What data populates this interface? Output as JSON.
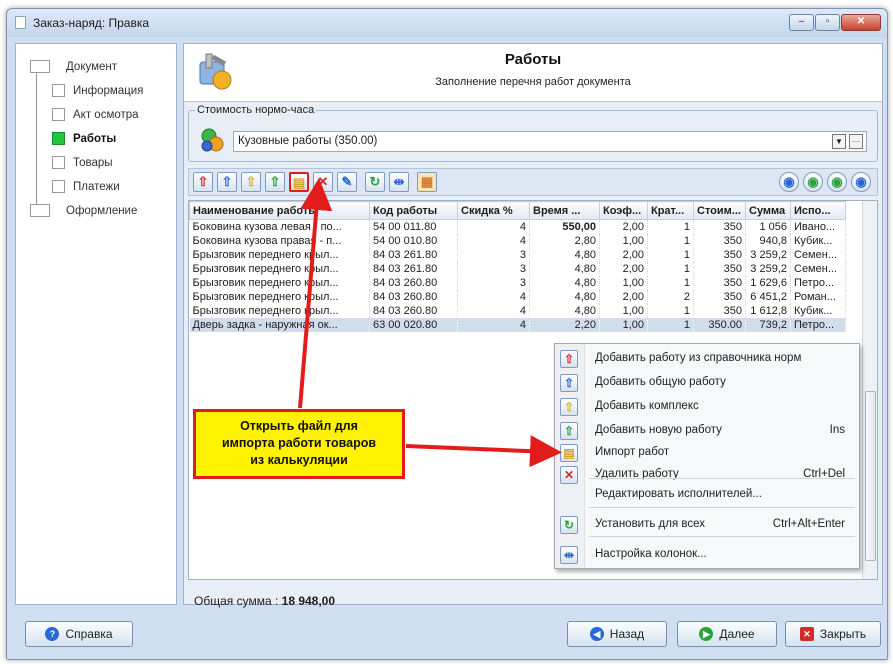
{
  "window": {
    "title": "Заказ-наряд: Правка",
    "min": "‒",
    "max": "▫",
    "close": "✕"
  },
  "nav": [
    {
      "label": "Документ",
      "active": false
    },
    {
      "label": "Информация",
      "active": false
    },
    {
      "label": "Акт осмотра",
      "active": false
    },
    {
      "label": "Работы",
      "active": true
    },
    {
      "label": "Товары",
      "active": false
    },
    {
      "label": "Платежи",
      "active": false
    },
    {
      "label": "Оформление",
      "active": false
    }
  ],
  "header": {
    "title": "Работы",
    "subtitle": "Заполнение перечня работ документа"
  },
  "rate": {
    "group_label": "Стоимость нормо-часа",
    "value": "Кузовные работы (350.00)"
  },
  "table": {
    "columns": [
      "Наименование работы",
      "Код работы",
      "Скидка %",
      "Время ...",
      "Коэф...",
      "Крат...",
      "Стоим...",
      "Сумма",
      "Испо..."
    ],
    "rows": [
      [
        "Боковина кузова левая - по...",
        "54 00 011.80",
        "4",
        "550,00",
        "2,00",
        "1",
        "350",
        "1 056",
        "Ивано..."
      ],
      [
        "Боковина кузова правая - п...",
        "54 00 010.80",
        "4",
        "2,80",
        "1,00",
        "1",
        "350",
        "940,8",
        "Кубик..."
      ],
      [
        "Брызговик переднего крыл...",
        "84 03 261.80",
        "3",
        "4,80",
        "2,00",
        "1",
        "350",
        "3 259,2",
        "Семен..."
      ],
      [
        "Брызговик переднего крыл...",
        "84 03 261.80",
        "3",
        "4,80",
        "2,00",
        "1",
        "350",
        "3 259,2",
        "Семен..."
      ],
      [
        "Брызговик переднего крыл...",
        "84 03 260.80",
        "3",
        "4,80",
        "1,00",
        "1",
        "350",
        "1 629,6",
        "Петро..."
      ],
      [
        "Брызговик переднего крыл...",
        "84 03 260.80",
        "4",
        "4,80",
        "2,00",
        "2",
        "350",
        "6 451,2",
        "Роман..."
      ],
      [
        "Брызговик переднего крыл...",
        "84 03 260.80",
        "4",
        "4,80",
        "1,00",
        "1",
        "350",
        "1 612,8",
        "Кубик..."
      ],
      [
        "Дверь задка - наружная ок...",
        "63 00 020.80",
        "4",
        "2,20",
        "1,00",
        "1",
        "350.00",
        "739,2",
        "Петро..."
      ]
    ]
  },
  "total": {
    "label": "Общая сумма :",
    "value": "18 948,00"
  },
  "context_menu": [
    {
      "label": "Добавить работу из справочника норм",
      "shortcut": "",
      "icon": "add-norm-icon",
      "color": "#d42a2a"
    },
    {
      "label": "Добавить общую работу",
      "shortcut": "",
      "icon": "add-general-icon",
      "color": "#2a66d4"
    },
    {
      "label": "Добавить комплекс",
      "shortcut": "",
      "icon": "add-complex-icon",
      "color": "#d4b42a"
    },
    {
      "label": "Добавить новую работу",
      "shortcut": "Ins",
      "icon": "add-new-icon",
      "color": "#2aa23a"
    },
    {
      "label": "Импорт работ",
      "shortcut": "",
      "icon": "import-icon",
      "color": "#d4a42a"
    },
    {
      "label": "Удалить работу",
      "shortcut": "Ctrl+Del",
      "icon": "delete-icon",
      "color": "#d42a2a"
    },
    {
      "label": "Редактировать исполнителей...",
      "shortcut": "",
      "icon": "",
      "color": ""
    },
    {
      "label": "Установить для всех",
      "shortcut": "Ctrl+Alt+Enter",
      "icon": "apply-all-icon",
      "color": "#2aa23a"
    },
    {
      "label": "Настройка колонок...",
      "shortcut": "",
      "icon": "columns-icon",
      "color": "#2a66d4"
    }
  ],
  "callout": {
    "line1": "Открыть файл для",
    "line2": "импорта работи товаров",
    "line3": "из калькуляции"
  },
  "buttons": {
    "help": "Справка",
    "back": "Назад",
    "next": "Далее",
    "close": "Закрыть"
  }
}
